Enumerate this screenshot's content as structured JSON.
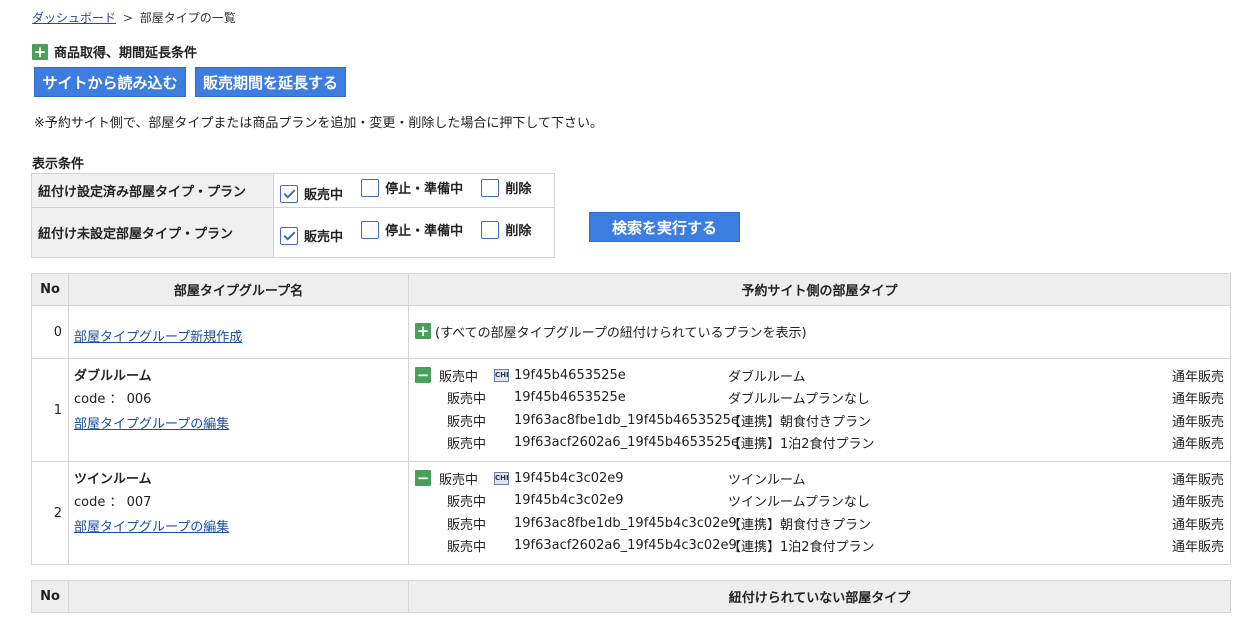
{
  "breadcrumb": {
    "home": "ダッシュボード",
    "sep": ">",
    "current": "部屋タイプの一覧"
  },
  "section": {
    "title": "商品取得、期間延長条件"
  },
  "buttons": {
    "read": "サイトから読み込む",
    "extend": "販売期間を延長する",
    "search": "検索を実行する"
  },
  "note": "※予約サイト側で、部屋タイプまたは商品プランを追加・変更・削除した場合に押下して下さい。",
  "conditions": {
    "title": "表示条件",
    "rows": [
      {
        "label": "紐付け設定済み部屋タイプ・プラン",
        "options": [
          {
            "label": "販売中",
            "checked": true
          },
          {
            "label": "停止・準備中",
            "checked": false
          },
          {
            "label": "削除",
            "checked": false
          }
        ]
      },
      {
        "label": "紐付け未設定部屋タイプ・プラン",
        "options": [
          {
            "label": "販売中",
            "checked": true
          },
          {
            "label": "停止・準備中",
            "checked": false
          },
          {
            "label": "削除",
            "checked": false
          }
        ]
      }
    ]
  },
  "table": {
    "headers": {
      "no": "No",
      "group": "部屋タイプグループ名",
      "site": "予約サイト側の部屋タイプ"
    },
    "new_row": {
      "no": "0",
      "link": "部屋タイプグループ新規作成",
      "all_plans": "(すべての部屋タイプグループの紐付けられているプランを表示)"
    },
    "groups": [
      {
        "no": "1",
        "name": "ダブルルーム",
        "code_label": "code ： 006",
        "edit_link": "部屋タイプグループの編集",
        "plans": [
          {
            "status": "販売中",
            "chi": "CHI",
            "code": "19f45b4653525e",
            "name": "ダブルルーム",
            "period": "通年販売"
          },
          {
            "status": "販売中",
            "code": "19f45b4653525e",
            "name": "ダブルルームプランなし",
            "period": "通年販売"
          },
          {
            "status": "販売中",
            "code": "19f63ac8fbe1db_19f45b4653525e",
            "name": "【連携】朝食付きプラン",
            "period": "通年販売"
          },
          {
            "status": "販売中",
            "code": "19f63acf2602a6_19f45b4653525e",
            "name": "【連携】1泊2食付プラン",
            "period": "通年販売"
          }
        ]
      },
      {
        "no": "2",
        "name": "ツインルーム",
        "code_label": "code ： 007",
        "edit_link": "部屋タイプグループの編集",
        "plans": [
          {
            "status": "販売中",
            "chi": "CHI",
            "code": "19f45b4c3c02e9",
            "name": "ツインルーム",
            "period": "通年販売"
          },
          {
            "status": "販売中",
            "code": "19f45b4c3c02e9",
            "name": "ツインルームプランなし",
            "period": "通年販売"
          },
          {
            "status": "販売中",
            "code": "19f63ac8fbe1db_19f45b4c3c02e9",
            "name": "【連携】朝食付きプラン",
            "period": "通年販売"
          },
          {
            "status": "販売中",
            "code": "19f63acf2602a6_19f45b4c3c02e9",
            "name": "【連携】1泊2食付プラン",
            "period": "通年販売"
          }
        ]
      }
    ]
  },
  "unlinked": {
    "headers": {
      "no": "No",
      "blank": "",
      "title": "紐付けられていない部屋タイプ"
    }
  },
  "icons": {
    "plus": "plus-icon",
    "minus": "minus-icon",
    "chi": "chi-badge-icon",
    "check": "check-icon"
  },
  "colors": {
    "button": "#3d7de0",
    "icon_green": "#4aa05a",
    "link": "#1a4fa0",
    "header_bg": "#eeeeee"
  }
}
